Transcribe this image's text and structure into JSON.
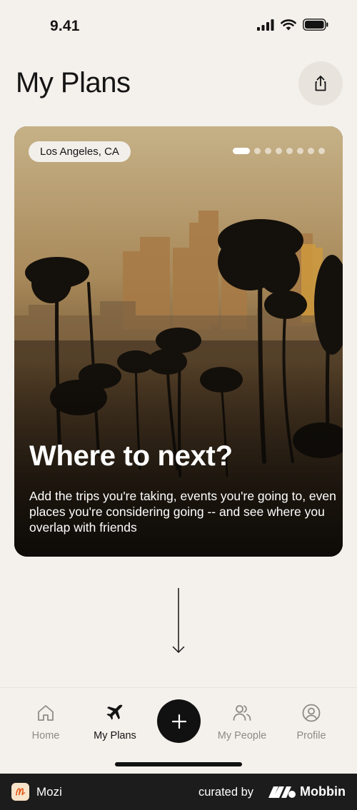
{
  "status_bar": {
    "time": "9.41"
  },
  "header": {
    "title": "My Plans"
  },
  "hero": {
    "location": "Los Angeles, CA",
    "page_count": 8,
    "active_page": 0,
    "headline": "Where to next?",
    "body": "Add the trips you're taking, events you're going to, even places you're considering going -- and see where you overlap with friends"
  },
  "tabs": [
    {
      "label": "Home",
      "icon": "home-icon"
    },
    {
      "label": "My Plans",
      "icon": "airplane-icon",
      "active": true
    },
    {
      "label": "My People",
      "icon": "people-icon"
    },
    {
      "label": "Profile",
      "icon": "profile-icon"
    }
  ],
  "footer": {
    "app_name": "Mozi",
    "curated_by": "curated by",
    "brand": "Mobbin"
  },
  "colors": {
    "background": "#f4f0eb",
    "ink": "#141414",
    "inactive": "#8f8a85",
    "footer": "#1c1c1c"
  }
}
